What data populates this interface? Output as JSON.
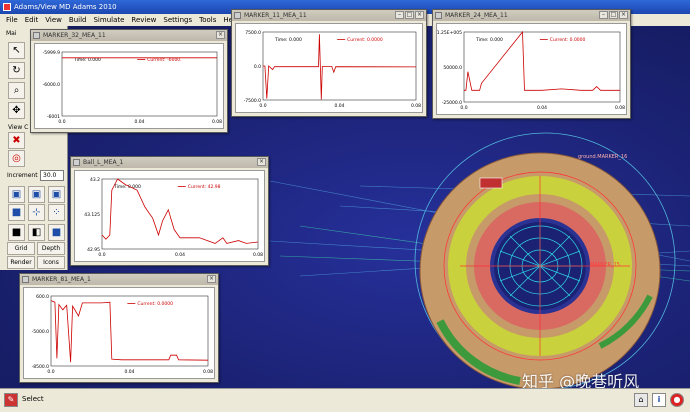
{
  "app": {
    "title": "Adams/View MD Adams 2010"
  },
  "menu": [
    "File",
    "Edit",
    "View",
    "Build",
    "Simulate",
    "Review",
    "Settings",
    "Tools",
    "Help"
  ],
  "toolbox": {
    "view_label": "View C",
    "increment_label": "Increment",
    "increment_value": "30.0",
    "grid_label": "Grid",
    "depth_label": "Depth",
    "render_label": "Render",
    "icons_label": "Icons",
    "partial_tab_label": "Mai"
  },
  "viewport": {
    "part_label": "ground.MARKER_16",
    "marker_label": "MARKER_15"
  },
  "colors": {
    "curve": "#cc0000",
    "viewport_bg": "#1b2274",
    "ring_tan": "#c79a6a",
    "ring_yellow": "#c9d23c",
    "ring_salmon": "#d86a62",
    "wire_cyan": "#2ed7e6"
  },
  "plots": [
    {
      "title": "MARKER_32_MEA_11",
      "time_label": "Time: 0.000",
      "current_label": "Current: -6000.",
      "y_ticks": [
        "-5999.9",
        "-6000.0",
        "-6001"
      ],
      "x_ticks": [
        "0.0",
        "0.04",
        "0.08"
      ],
      "xlim": [
        0,
        0.08
      ],
      "ylim": [
        -6001,
        -5999.9
      ],
      "points": [
        [
          0,
          -6000
        ],
        [
          0.08,
          -6000
        ]
      ]
    },
    {
      "title": "MARKER_11_MEA_11",
      "time_label": "Time: 0.000",
      "current_label": "Current: 0.0000",
      "y_ticks": [
        "7500.0",
        "0.0",
        "-7500.0"
      ],
      "x_ticks": [
        "0.0",
        "0.04",
        "0.08"
      ],
      "xlim": [
        0,
        0.08
      ],
      "ylim": [
        -7500,
        7500
      ],
      "points": [
        [
          0,
          0
        ],
        [
          0.001,
          0
        ],
        [
          0.002,
          -7200
        ],
        [
          0.003,
          0
        ],
        [
          0.005,
          -800
        ],
        [
          0.006,
          -150
        ],
        [
          0.029,
          -150
        ],
        [
          0.0295,
          7000
        ],
        [
          0.0305,
          -7400
        ],
        [
          0.031,
          -100
        ],
        [
          0.036,
          -100
        ],
        [
          0.037,
          -1400
        ],
        [
          0.038,
          -150
        ],
        [
          0.08,
          -200
        ]
      ]
    },
    {
      "title": "MARKER_24_MEA_11",
      "time_label": "Time: 0.000",
      "current_label": "Current: 0.0000",
      "y_ticks": [
        "1.25E+005",
        "50000.0",
        "-25000.0"
      ],
      "x_ticks": [
        "0.0",
        "0.04",
        "0.08"
      ],
      "xlim": [
        0,
        0.08
      ],
      "ylim": [
        -25000,
        125000
      ],
      "points": [
        [
          0,
          0
        ],
        [
          0.001,
          0
        ],
        [
          0.002,
          40000
        ],
        [
          0.004,
          0
        ],
        [
          0.008,
          0
        ],
        [
          0.009,
          15000
        ],
        [
          0.03,
          125000
        ],
        [
          0.031,
          0
        ],
        [
          0.04,
          0
        ],
        [
          0.05,
          3000
        ],
        [
          0.06,
          0
        ],
        [
          0.066,
          0
        ],
        [
          0.068,
          8000
        ],
        [
          0.07,
          0
        ],
        [
          0.08,
          0
        ]
      ]
    },
    {
      "title": "Ball_L_MEA_1",
      "time_label": "Time: 0.000",
      "current_label": "Current: 42.98",
      "y_ticks": [
        "43.2",
        "43.125",
        "42.95"
      ],
      "x_ticks": [
        "0.0",
        "0.04",
        "0.08"
      ],
      "xlim": [
        0,
        0.08
      ],
      "ylim": [
        42.95,
        43.2
      ],
      "points": [
        [
          0,
          43.0
        ],
        [
          0.002,
          42.985
        ],
        [
          0.004,
          43.0
        ],
        [
          0.005,
          43.16
        ],
        [
          0.008,
          43.2
        ],
        [
          0.012,
          43.18
        ],
        [
          0.018,
          43.16
        ],
        [
          0.022,
          43.1
        ],
        [
          0.026,
          43.06
        ],
        [
          0.029,
          43.0
        ],
        [
          0.031,
          43.05
        ],
        [
          0.034,
          43.09
        ],
        [
          0.037,
          43.02
        ],
        [
          0.04,
          42.99
        ],
        [
          0.05,
          42.99
        ],
        [
          0.058,
          42.97
        ],
        [
          0.062,
          42.99
        ],
        [
          0.064,
          42.97
        ],
        [
          0.07,
          42.98
        ],
        [
          0.074,
          42.97
        ],
        [
          0.08,
          42.975
        ]
      ]
    },
    {
      "title": "MARKER_81_MEA_1",
      "time_label": "",
      "current_label": "Current: 0.0000",
      "y_ticks": [
        "600.0",
        "-5000.0",
        "-8500.0"
      ],
      "x_ticks": [
        "0.0",
        "0.04",
        "0.08"
      ],
      "xlim": [
        0,
        0.08
      ],
      "ylim": [
        -8500,
        600
      ],
      "points": [
        [
          0,
          0
        ],
        [
          0.002,
          -200
        ],
        [
          0.003,
          -7500
        ],
        [
          0.004,
          -500
        ],
        [
          0.006,
          -1200
        ],
        [
          0.008,
          -600
        ],
        [
          0.01,
          -8000
        ],
        [
          0.011,
          -700
        ],
        [
          0.014,
          -2000
        ],
        [
          0.016,
          -300
        ],
        [
          0.026,
          -300
        ],
        [
          0.03,
          -200
        ],
        [
          0.031,
          -7600
        ],
        [
          0.036,
          -7700
        ],
        [
          0.06,
          -7700
        ],
        [
          0.061,
          -7100
        ],
        [
          0.064,
          -7100
        ],
        [
          0.065,
          -7700
        ],
        [
          0.08,
          -7750
        ]
      ]
    }
  ],
  "status": {
    "text": "Select"
  },
  "watermark": "知乎 @晚巷听风"
}
